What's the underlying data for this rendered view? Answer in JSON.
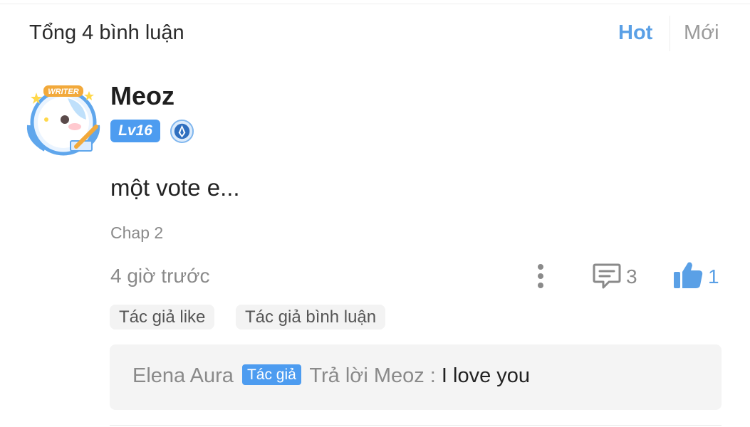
{
  "header": {
    "title": "Tổng 4 bình luận"
  },
  "sort": {
    "hot_label": "Hot",
    "new_label": "Mới",
    "active": "Hot"
  },
  "comment": {
    "username": "Meoz",
    "level_badge": "Lv16",
    "avatar_frame_text": "WRITER",
    "text": "một vote e...",
    "chapter": "Chap 2",
    "time": "4 giờ trước",
    "reply_count": "3",
    "like_count": "1",
    "tags": [
      "Tác giả like",
      "Tác giả bình luận"
    ],
    "icons": [
      "more-vertical-icon",
      "reply-icon",
      "thumbs-up-icon",
      "medal-icon"
    ]
  },
  "reply": {
    "author": "Elena Aura",
    "author_badge": "Tác giả",
    "reply_to": "Trả lời Meoz :",
    "text": "I love you"
  },
  "colors": {
    "accent": "#5aa0e6",
    "badge": "#4d9cf0",
    "muted": "#8a8a8a"
  }
}
